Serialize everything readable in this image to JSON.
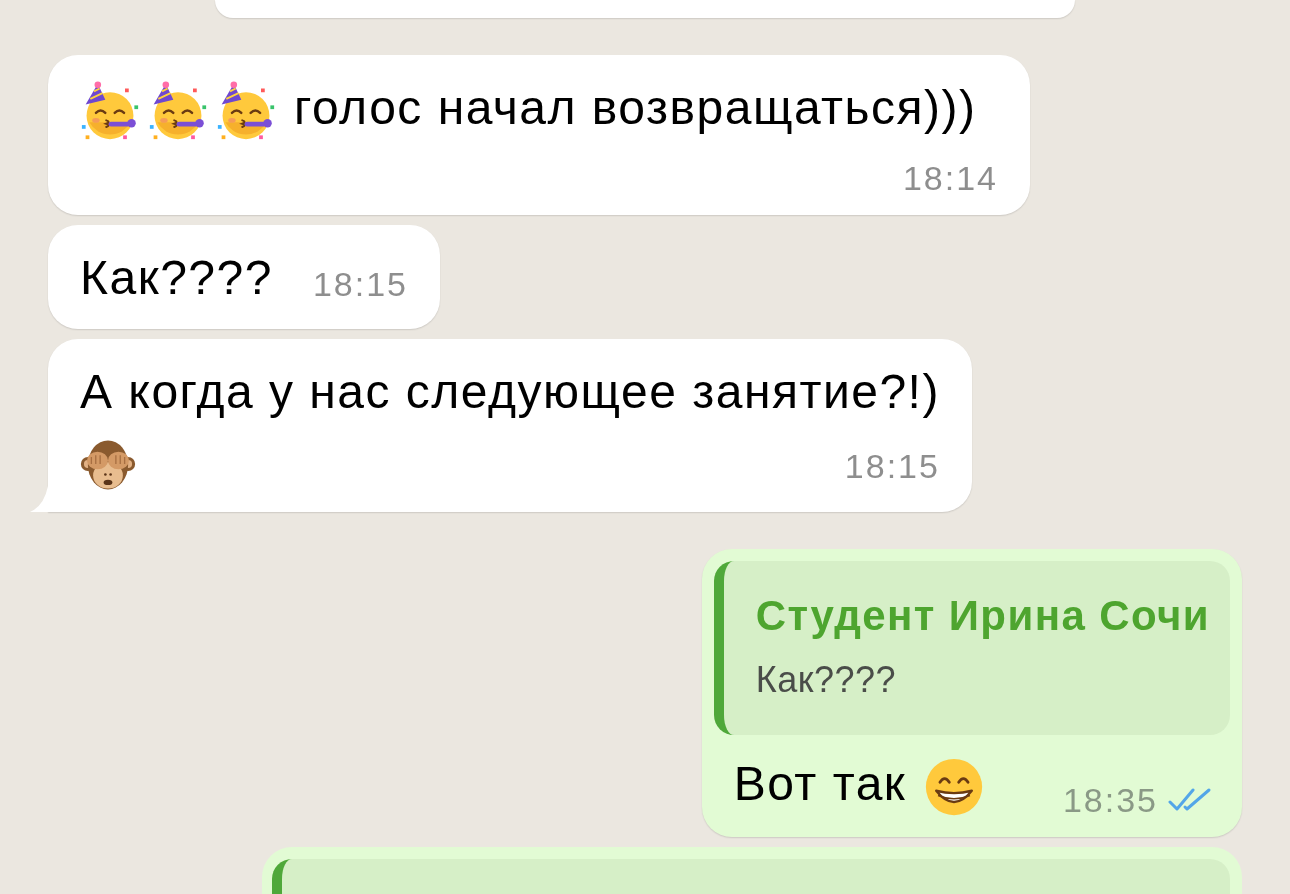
{
  "messages": [
    {
      "kind": "system",
      "cut_off": true
    },
    {
      "kind": "incoming",
      "cut_off": false,
      "lines": [
        [
          {
            "kind": "partyface"
          },
          {
            "kind": "partyface"
          },
          {
            "kind": "partyface"
          },
          {
            "kind": "text",
            "text": "голос начал возвращаться)))"
          }
        ]
      ],
      "time": "18:14"
    },
    {
      "kind": "incoming",
      "cut_off": false,
      "lines": [
        [
          {
            "kind": "text",
            "text": "Как????"
          }
        ]
      ],
      "time": "18:15"
    },
    {
      "kind": "incoming",
      "cut_off": false,
      "lines": [
        [
          {
            "kind": "text",
            "text": "А когда у нас следующее занятие?!)"
          }
        ],
        [
          {
            "kind": "monkey"
          }
        ]
      ],
      "time": "18:15"
    },
    {
      "kind": "outgoing",
      "cut_off": false,
      "quoted": true,
      "quote": {
        "author": "Студент Ирина Сочи",
        "text": "Как????"
      },
      "lines": [
        [
          {
            "kind": "text",
            "text": "Вот так"
          },
          {
            "kind": "grin"
          }
        ]
      ],
      "time": "18:35",
      "read": true
    },
    {
      "kind": "outgoing",
      "cut_off": true,
      "quoted": true
    }
  ]
}
